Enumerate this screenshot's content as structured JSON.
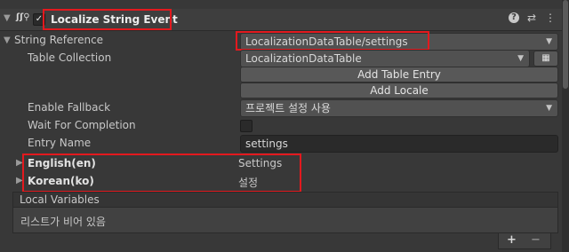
{
  "component": {
    "title": "Localize String Event",
    "enabled_checkbox": true,
    "icons": [
      "localize-script-icon",
      "help-icon",
      "presets-icon",
      "kebab-menu-icon"
    ]
  },
  "string_reference": {
    "label": "String Reference",
    "value": "LocalizationDataTable/settings"
  },
  "table_collection": {
    "label": "Table Collection",
    "value": "LocalizationDataTable"
  },
  "buttons": {
    "add_table_entry": "Add Table Entry",
    "add_locale": "Add Locale"
  },
  "enable_fallback": {
    "label": "Enable Fallback",
    "value": "프로젝트 설정 사용"
  },
  "wait_for_completion": {
    "label": "Wait For Completion",
    "checked": false
  },
  "entry_name": {
    "label": "Entry Name",
    "value": "settings"
  },
  "locales": [
    {
      "name": "English(en)",
      "value": "Settings"
    },
    {
      "name": "Korean(ko)",
      "value": "설정"
    }
  ],
  "local_variables": {
    "header": "Local Variables",
    "empty_text": "리스트가 비어 있음",
    "add_label": "+",
    "remove_label": "−"
  },
  "colors": {
    "highlight": "#e3191e",
    "background": "#383838",
    "field": "#2a2a2a"
  }
}
